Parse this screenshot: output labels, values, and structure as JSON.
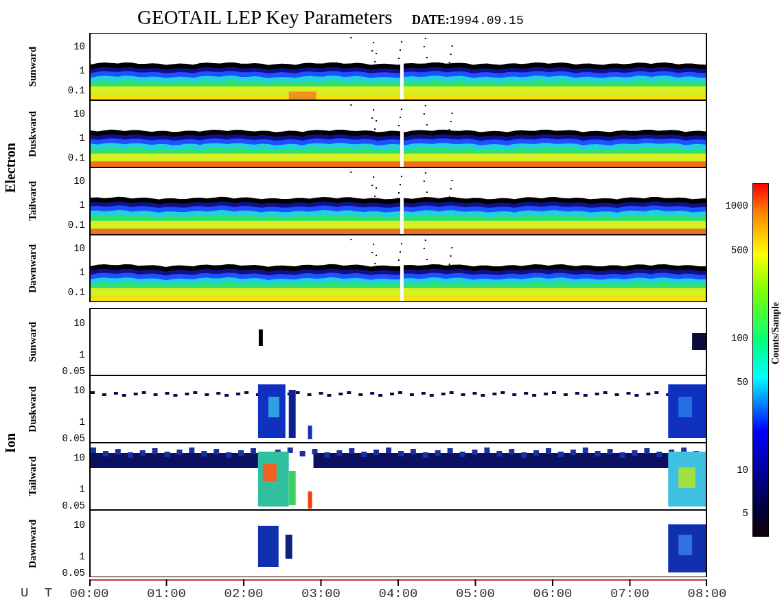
{
  "title": "GEOTAIL LEP Key Parameters",
  "date": "**DATE:**1994.09.15",
  "groups": [
    {
      "species": "Electron",
      "kind": "electron",
      "panels": [
        {
          "direction": "Sunward",
          "y_ticks": [
            "10",
            "1",
            "0.1"
          ]
        },
        {
          "direction": "Duskward",
          "y_ticks": [
            "10",
            "1",
            "0.1"
          ]
        },
        {
          "direction": "Tailward",
          "y_ticks": [
            "10",
            "1",
            "0.1"
          ]
        },
        {
          "direction": "Dawnward",
          "y_ticks": [
            "10",
            "1",
            "0.1"
          ]
        }
      ]
    },
    {
      "species": "Ion",
      "kind": "ion",
      "panels": [
        {
          "direction": "Sunward",
          "y_ticks": [
            "10",
            "1",
            "0.05"
          ]
        },
        {
          "direction": "Duskward",
          "y_ticks": [
            "10",
            "1",
            "0.05"
          ]
        },
        {
          "direction": "Tailward",
          "y_ticks": [
            "10",
            "1",
            "0.05"
          ]
        },
        {
          "direction": "Dawnward",
          "y_ticks": [
            "10",
            "1",
            "0.05"
          ]
        }
      ]
    }
  ],
  "x_axis": {
    "label": "U T",
    "ticks": [
      "00:00",
      "01:00",
      "02:00",
      "03:00",
      "04:00",
      "05:00",
      "06:00",
      "07:00",
      "08:00"
    ]
  },
  "colorbar": {
    "label": "Counts/Sample",
    "ticks": [
      "1000",
      "500",
      "100",
      "50",
      "10",
      "5"
    ]
  }
}
